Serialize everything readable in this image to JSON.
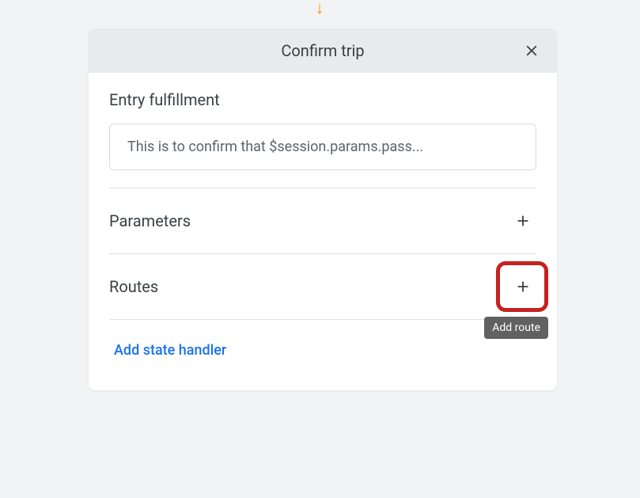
{
  "indicator": {
    "glyph": "↓"
  },
  "header": {
    "title": "Confirm trip"
  },
  "sections": {
    "entry_fulfillment": {
      "heading": "Entry fulfillment",
      "value": "This is to confirm that $session.params.pass..."
    },
    "parameters": {
      "label": "Parameters"
    },
    "routes": {
      "label": "Routes",
      "tooltip": "Add route"
    }
  },
  "actions": {
    "add_state_handler": "Add state handler"
  }
}
